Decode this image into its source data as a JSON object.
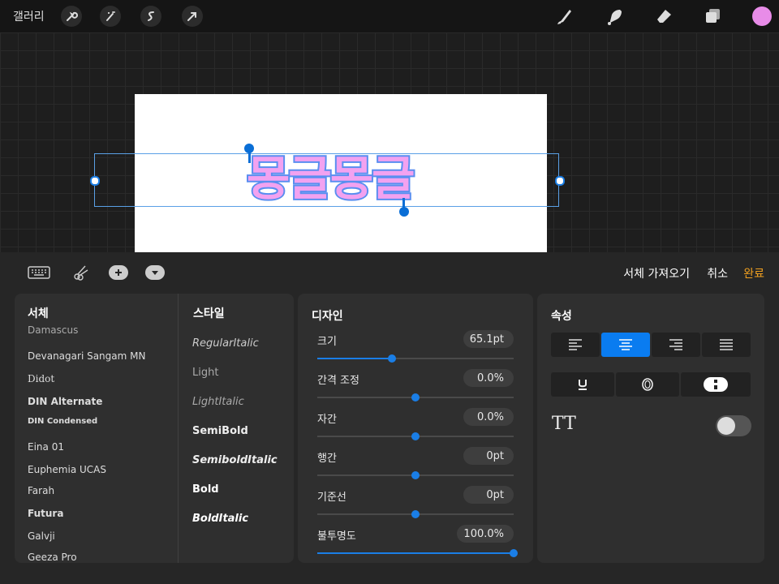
{
  "topbar": {
    "gallery_label": "갤러리",
    "tools_left": [
      "wrench-icon",
      "magic-wand-icon",
      "selection-s-icon",
      "arrow-transform-icon"
    ],
    "tools_right": [
      "brush-icon",
      "smudge-icon",
      "eraser-icon",
      "layers-icon"
    ],
    "color_swatch": "#e88ce8"
  },
  "canvas": {
    "text": "몽글몽글",
    "text_fill": "#f2a2f0",
    "text_stroke": "#5a8ef0"
  },
  "panel": {
    "toolbar": {
      "keyboard_icon": "keyboard-icon",
      "cut_icon": "scissors-icon",
      "add_icon": "plus-icon",
      "dropdown_icon": "chevron-down-icon",
      "import_font_label": "서체 가져오기",
      "cancel_label": "취소",
      "done_label": "완료"
    },
    "fonts": {
      "title": "서체",
      "items": [
        "Damascus",
        "Devanagari Sangam MN",
        "Didot",
        "DIN Alternate",
        "DIN Condensed",
        "Eina 01",
        "Euphemia  UCAS",
        "Farah",
        "Futura",
        "Galvji",
        "Geeza Pro"
      ]
    },
    "styles": {
      "title": "스타일",
      "items": [
        "RegularItalic",
        "Light",
        "LightItalic",
        "SemiBold",
        "SemiboldItalic",
        "Bold",
        "BoldItalic"
      ]
    },
    "design": {
      "title": "디자인",
      "rows": [
        {
          "label": "크기",
          "value": "65.1pt",
          "slider": 0.38
        },
        {
          "label": "간격 조정",
          "value": "0.0%",
          "slider": 0.5
        },
        {
          "label": "자간",
          "value": "0.0%",
          "slider": 0.5
        },
        {
          "label": "행간",
          "value": "0pt",
          "slider": 0.5
        },
        {
          "label": "기준선",
          "value": "0pt",
          "slider": 0.5
        },
        {
          "label": "불투명도",
          "value": "100.0%",
          "slider": 1.0
        }
      ]
    },
    "attributes": {
      "title": "속성",
      "align_buttons": [
        "align-left-icon",
        "align-center-icon",
        "align-right-icon",
        "align-justify-icon"
      ],
      "active_align": "align-center",
      "style_buttons": [
        "underline-icon",
        "outline-icon",
        "vertical-text-icon"
      ],
      "tt_label": "TT",
      "tt_toggle": false
    },
    "accent_color": "#0a7cf0"
  }
}
